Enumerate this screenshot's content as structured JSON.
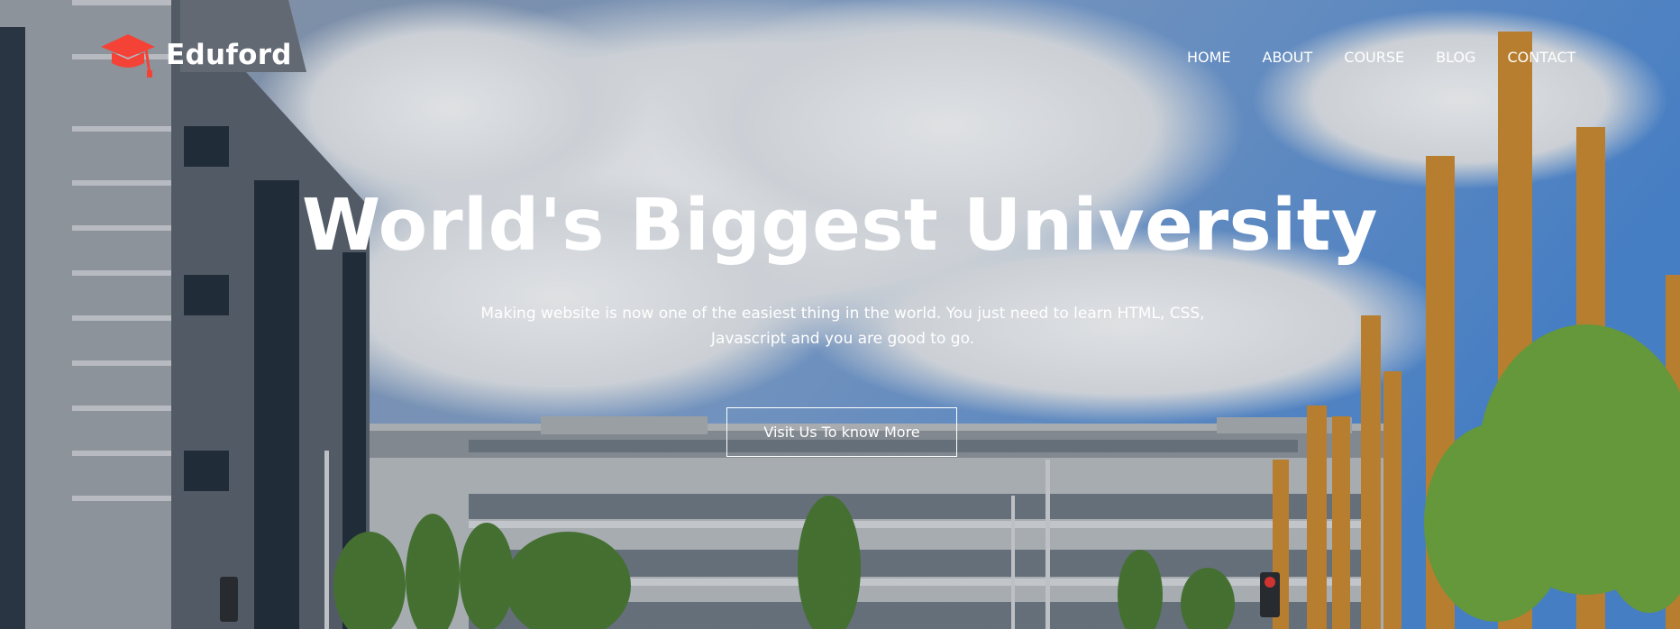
{
  "brand": {
    "name": "Eduford",
    "icon": "graduation-cap-icon",
    "accent": "#f44336"
  },
  "nav": {
    "items": [
      {
        "label": "HOME"
      },
      {
        "label": "ABOUT"
      },
      {
        "label": "COURSE"
      },
      {
        "label": "BLOG"
      },
      {
        "label": "CONTACT"
      }
    ]
  },
  "hero": {
    "headline": "World's Biggest University",
    "subtext": "Making website is now one of the easiest thing in the world. You just need to learn HTML, CSS, Javascript and you are good to go.",
    "cta_label": "Visit Us To know More"
  }
}
